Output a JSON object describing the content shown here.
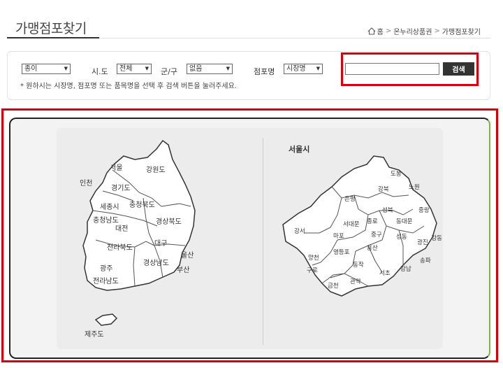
{
  "header": {
    "title": "가맹점포찾기"
  },
  "breadcrumb": {
    "home": "홈",
    "level1": "온누리상품권",
    "level2": "가맹점포찾기",
    "sep": ">"
  },
  "search": {
    "type_select": "종이",
    "sido_label": "시.도",
    "sido_select": "전체",
    "gungu_label": "군/구",
    "gungu_select": "없음",
    "store_label": "점포명",
    "store_select": "시장명",
    "help_text": "* 원하시는 시장명, 점포명 또는 품목명을 선택 후 검색 버튼을 눌러주세요.",
    "input_value": "",
    "button_label": "검색"
  },
  "korea_map": {
    "regions": [
      "서울",
      "강원도",
      "인천",
      "경기도",
      "세종시",
      "충청북도",
      "충청남도",
      "대전",
      "경상북도",
      "전라북도",
      "대구",
      "울산",
      "경상남도",
      "부산",
      "광주",
      "전라남도",
      "제주도"
    ]
  },
  "seoul_map": {
    "title": "서울시",
    "districts": [
      "도봉",
      "강북",
      "노원",
      "은평",
      "성북",
      "중랑",
      "종로",
      "동대문",
      "강서",
      "서대문",
      "중구",
      "마포",
      "성동",
      "광진",
      "강동",
      "용산",
      "영등포",
      "양천",
      "동작",
      "송파",
      "구로",
      "강남",
      "서초",
      "금천",
      "관악"
    ]
  },
  "colors": {
    "accent_red": "#d4000c",
    "frame_green": "#7cb342",
    "button_dark": "#333333"
  }
}
